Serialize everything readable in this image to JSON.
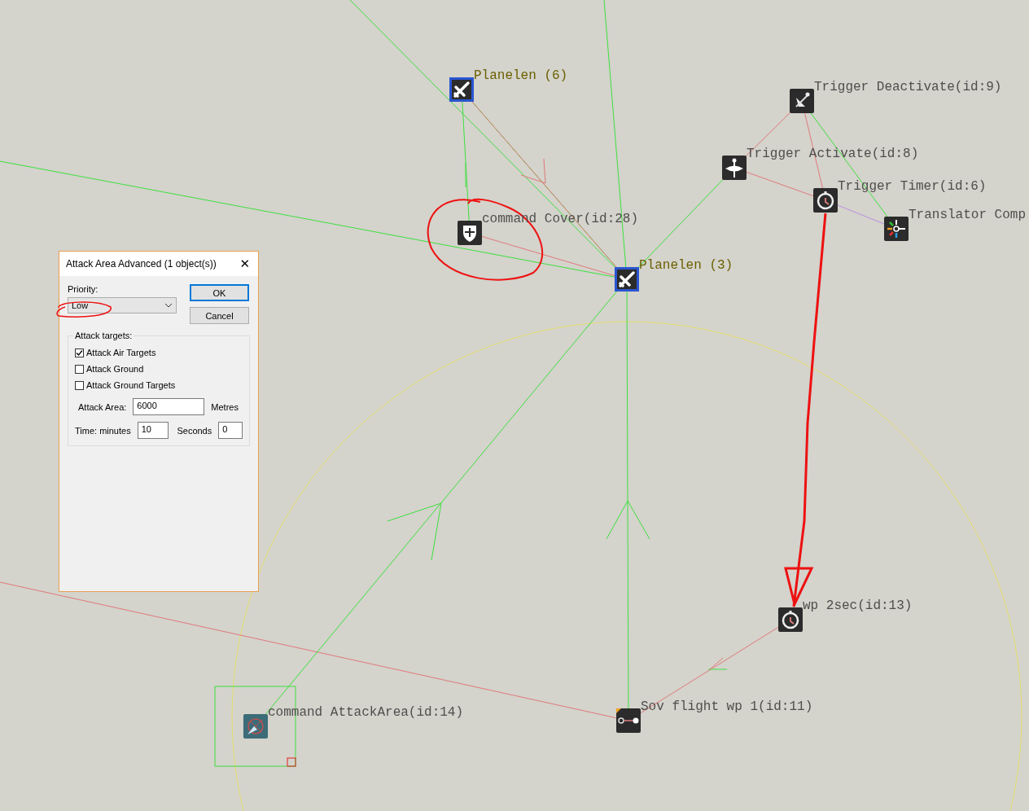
{
  "nodes": [
    {
      "kind": "plane",
      "label": "Planelen (6)"
    },
    {
      "kind": "cover",
      "label": "command Cover(id:28)"
    },
    {
      "kind": "plane",
      "label": "Planelen (3)"
    },
    {
      "kind": "deactivate",
      "label": "Trigger Deactivate(id:9)"
    },
    {
      "kind": "activate",
      "label": "Trigger Activate(id:8)"
    },
    {
      "kind": "timer",
      "label": "Trigger Timer(id:6)"
    },
    {
      "kind": "translator",
      "label": "Translator Comp"
    },
    {
      "kind": "timer",
      "label": "wp 2sec(id:13)"
    },
    {
      "kind": "waypoint",
      "label": "Sov flight wp 1(id:11)"
    },
    {
      "kind": "attack",
      "label": "command AttackArea(id:14)"
    }
  ],
  "dialog": {
    "title": "Attack Area Advanced (1 object(s))",
    "close": "✕",
    "priority_label": "Priority:",
    "priority_value": "Low",
    "buttons": [
      {
        "label": "OK",
        "default": true
      },
      {
        "label": "Cancel",
        "default": false
      }
    ],
    "group_label": "Attack targets:",
    "checkboxes": [
      {
        "label": "Attack Air Targets",
        "checked": true
      },
      {
        "label": "Attack Ground",
        "checked": false
      },
      {
        "label": "Attack Ground Targets",
        "checked": false
      }
    ],
    "area_label": "Attack Area:",
    "area_value": "6000",
    "area_unit": "Metres",
    "minutes_label": "Time: minutes",
    "minutes_value": "10",
    "seconds_label": "Seconds",
    "seconds_value": "0"
  }
}
